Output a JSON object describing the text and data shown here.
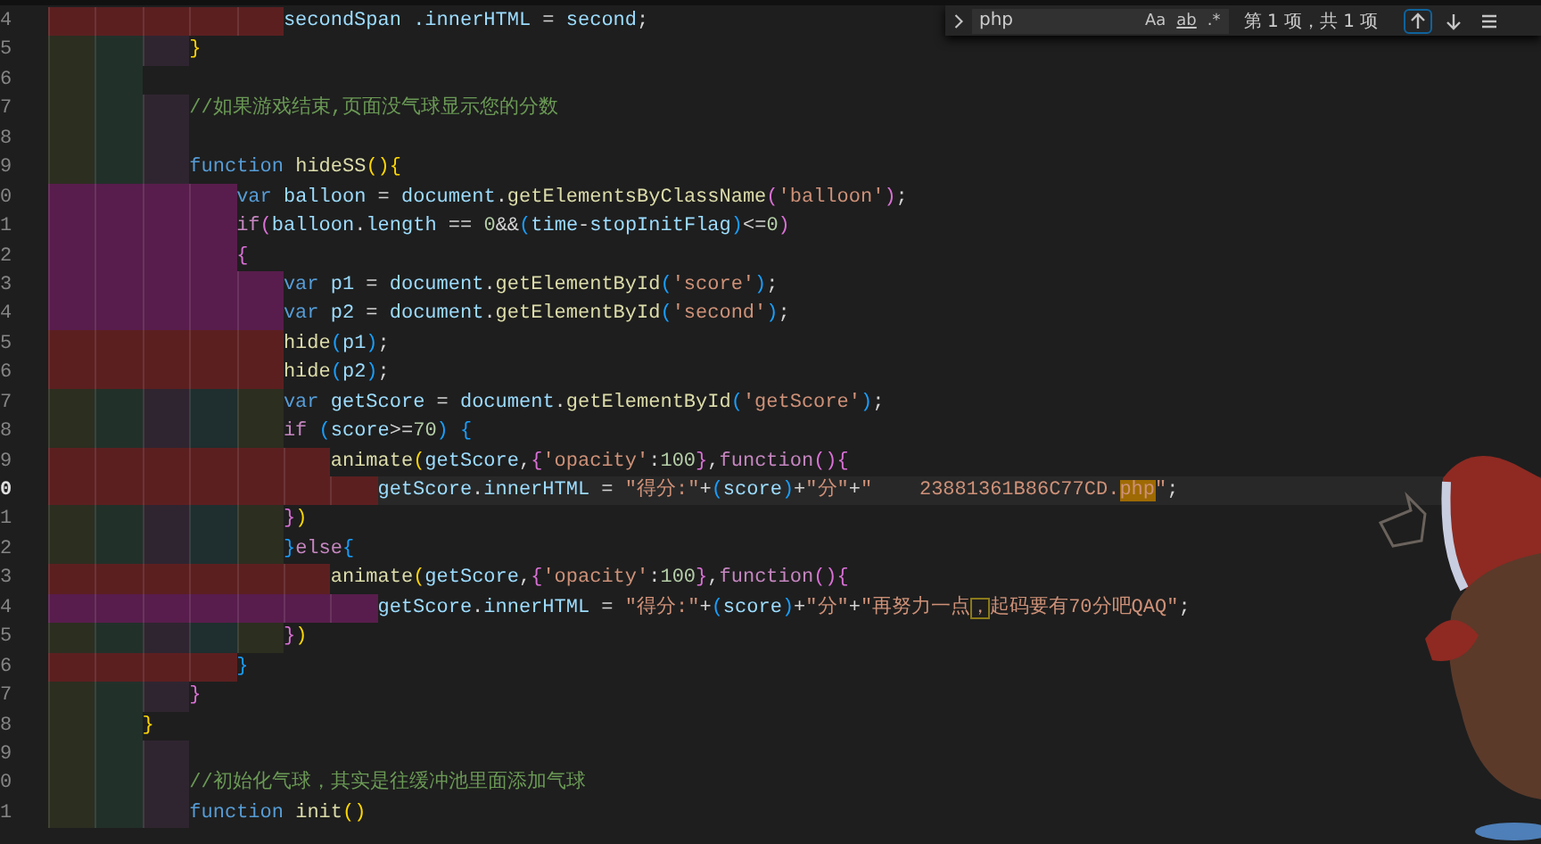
{
  "find": {
    "value": "php",
    "count": "第 1 项，共 1 项",
    "options": [
      {
        "kind": "case",
        "label": "Aa"
      },
      {
        "kind": "word",
        "label": "ab"
      },
      {
        "kind": "regex",
        "label": ".*"
      }
    ]
  },
  "lines": [
    {
      "number": "4",
      "current": false,
      "guides": [
        {
          "color": "#5c1f20"
        },
        {
          "color": "#5c1f20"
        },
        {
          "color": "#5c1f20"
        },
        {
          "color": "#5c1f20"
        },
        {
          "color": "#5c1f20"
        }
      ],
      "tokens": [
        {
          "text": "secondSpan .innerHTML",
          "kind": "id"
        },
        {
          "text": " = ",
          "kind": "op"
        },
        {
          "text": "second",
          "kind": "id"
        },
        {
          "text": ";",
          "kind": "op"
        }
      ]
    },
    {
      "number": "5",
      "current": false,
      "guides": [
        {
          "color": "#2c2e20"
        },
        {
          "color": "#22302a"
        },
        {
          "color": "#2f2530"
        }
      ],
      "tokens": [
        {
          "text": "}",
          "kind": "b1"
        }
      ]
    },
    {
      "number": "6",
      "current": false,
      "guides": [
        {
          "color": "#2c2e20"
        },
        {
          "color": "#22302a"
        }
      ]
    },
    {
      "number": "7",
      "current": false,
      "guides": [
        {
          "color": "#2c2e20"
        },
        {
          "color": "#22302a"
        },
        {
          "color": "#2f2530"
        }
      ],
      "tokens": [
        {
          "text": "//如果游戏结束,页面没气球显示您的分数",
          "kind": "cmt"
        }
      ]
    },
    {
      "number": "8",
      "current": false,
      "guides": [
        {
          "color": "#2c2e20"
        },
        {
          "color": "#22302a"
        },
        {
          "color": "#2f2530"
        }
      ]
    },
    {
      "number": "9",
      "current": false,
      "guides": [
        {
          "color": "#2c2e20"
        },
        {
          "color": "#22302a"
        },
        {
          "color": "#2f2530"
        }
      ],
      "tokens": [
        {
          "text": "function ",
          "kind": "kw"
        },
        {
          "text": "hideSS",
          "kind": "fn"
        },
        {
          "text": "(){",
          "kind": "b1"
        }
      ]
    },
    {
      "number": "0",
      "current": false,
      "guides": [
        {
          "color": "#581d4c"
        },
        {
          "color": "#581d4c"
        },
        {
          "color": "#581d4c"
        },
        {
          "color": "#581d4c"
        }
      ],
      "tokens": [
        {
          "text": "var ",
          "kind": "kw"
        },
        {
          "text": "balloon",
          "kind": "id"
        },
        {
          "text": " = ",
          "kind": "op"
        },
        {
          "text": "document",
          "kind": "id"
        },
        {
          "text": ".",
          "kind": "op"
        },
        {
          "text": "getElementsByClassName",
          "kind": "fn"
        },
        {
          "text": "(",
          "kind": "b2"
        },
        {
          "text": "'balloon'",
          "kind": "str"
        },
        {
          "text": ")",
          "kind": "b2"
        },
        {
          "text": ";",
          "kind": "op"
        }
      ]
    },
    {
      "number": "1",
      "current": false,
      "guides": [
        {
          "color": "#581d4c"
        },
        {
          "color": "#581d4c"
        },
        {
          "color": "#581d4c"
        },
        {
          "color": "#581d4c"
        }
      ],
      "tokens": [
        {
          "text": "if",
          "kind": "ctrl"
        },
        {
          "text": "(",
          "kind": "b2"
        },
        {
          "text": "balloon",
          "kind": "id"
        },
        {
          "text": ".",
          "kind": "op"
        },
        {
          "text": "length",
          "kind": "id"
        },
        {
          "text": " == ",
          "kind": "op"
        },
        {
          "text": "0",
          "kind": "num"
        },
        {
          "text": "&&",
          "kind": "op"
        },
        {
          "text": "(",
          "kind": "b3"
        },
        {
          "text": "time",
          "kind": "id"
        },
        {
          "text": "-",
          "kind": "op"
        },
        {
          "text": "stopInitFlag",
          "kind": "id"
        },
        {
          "text": ")",
          "kind": "b3"
        },
        {
          "text": "<=",
          "kind": "op"
        },
        {
          "text": "0",
          "kind": "num"
        },
        {
          "text": ")",
          "kind": "b2"
        }
      ]
    },
    {
      "number": "2",
      "current": false,
      "guides": [
        {
          "color": "#581d4c"
        },
        {
          "color": "#581d4c"
        },
        {
          "color": "#581d4c"
        },
        {
          "color": "#581d4c"
        }
      ],
      "tokens": [
        {
          "text": "{",
          "kind": "b2"
        }
      ]
    },
    {
      "number": "3",
      "current": false,
      "guides": [
        {
          "color": "#581d4c"
        },
        {
          "color": "#581d4c"
        },
        {
          "color": "#581d4c"
        },
        {
          "color": "#581d4c"
        },
        {
          "color": "#581d4c"
        }
      ],
      "tokens": [
        {
          "text": "var ",
          "kind": "kw"
        },
        {
          "text": "p1",
          "kind": "id"
        },
        {
          "text": " = ",
          "kind": "op"
        },
        {
          "text": "document",
          "kind": "id"
        },
        {
          "text": ".",
          "kind": "op"
        },
        {
          "text": "getElementById",
          "kind": "fn"
        },
        {
          "text": "(",
          "kind": "b3"
        },
        {
          "text": "'score'",
          "kind": "str"
        },
        {
          "text": ")",
          "kind": "b3"
        },
        {
          "text": ";",
          "kind": "op"
        }
      ]
    },
    {
      "number": "4",
      "current": false,
      "guides": [
        {
          "color": "#581d4c"
        },
        {
          "color": "#581d4c"
        },
        {
          "color": "#581d4c"
        },
        {
          "color": "#581d4c"
        },
        {
          "color": "#581d4c"
        }
      ],
      "tokens": [
        {
          "text": "var ",
          "kind": "kw"
        },
        {
          "text": "p2",
          "kind": "id"
        },
        {
          "text": " = ",
          "kind": "op"
        },
        {
          "text": "document",
          "kind": "id"
        },
        {
          "text": ".",
          "kind": "op"
        },
        {
          "text": "getElementById",
          "kind": "fn"
        },
        {
          "text": "(",
          "kind": "b3"
        },
        {
          "text": "'second'",
          "kind": "str"
        },
        {
          "text": ")",
          "kind": "b3"
        },
        {
          "text": ";",
          "kind": "op"
        }
      ]
    },
    {
      "number": "5",
      "current": false,
      "guides": [
        {
          "color": "#5c1f20"
        },
        {
          "color": "#5c1f20"
        },
        {
          "color": "#5c1f20"
        },
        {
          "color": "#5c1f20"
        },
        {
          "color": "#5c1f20"
        }
      ],
      "tokens": [
        {
          "text": "hide",
          "kind": "fn"
        },
        {
          "text": "(",
          "kind": "b3"
        },
        {
          "text": "p1",
          "kind": "id"
        },
        {
          "text": ")",
          "kind": "b3"
        },
        {
          "text": ";",
          "kind": "op"
        }
      ]
    },
    {
      "number": "6",
      "current": false,
      "guides": [
        {
          "color": "#5c1f20"
        },
        {
          "color": "#5c1f20"
        },
        {
          "color": "#5c1f20"
        },
        {
          "color": "#5c1f20"
        },
        {
          "color": "#5c1f20"
        }
      ],
      "tokens": [
        {
          "text": "hide",
          "kind": "fn"
        },
        {
          "text": "(",
          "kind": "b3"
        },
        {
          "text": "p2",
          "kind": "id"
        },
        {
          "text": ")",
          "kind": "b3"
        },
        {
          "text": ";",
          "kind": "op"
        }
      ]
    },
    {
      "number": "7",
      "current": false,
      "guides": [
        {
          "color": "#2c2e20"
        },
        {
          "color": "#22302a"
        },
        {
          "color": "#2f2530"
        },
        {
          "color": "#1f2e2e"
        },
        {
          "color": "#2c2e20"
        }
      ],
      "tokens": [
        {
          "text": "var ",
          "kind": "kw"
        },
        {
          "text": "getScore",
          "kind": "id"
        },
        {
          "text": " = ",
          "kind": "op"
        },
        {
          "text": "document",
          "kind": "id"
        },
        {
          "text": ".",
          "kind": "op"
        },
        {
          "text": "getElementById",
          "kind": "fn"
        },
        {
          "text": "(",
          "kind": "b3"
        },
        {
          "text": "'getScore'",
          "kind": "str"
        },
        {
          "text": ")",
          "kind": "b3"
        },
        {
          "text": ";",
          "kind": "op"
        }
      ]
    },
    {
      "number": "8",
      "current": false,
      "guides": [
        {
          "color": "#2c2e20"
        },
        {
          "color": "#22302a"
        },
        {
          "color": "#2f2530"
        },
        {
          "color": "#1f2e2e"
        },
        {
          "color": "#2c2e20"
        }
      ],
      "tokens": [
        {
          "text": "if ",
          "kind": "ctrl"
        },
        {
          "text": "(",
          "kind": "b3"
        },
        {
          "text": "score",
          "kind": "id"
        },
        {
          "text": ">=",
          "kind": "op"
        },
        {
          "text": "70",
          "kind": "num"
        },
        {
          "text": ")",
          "kind": "b3"
        },
        {
          "text": " {",
          "kind": "b3"
        }
      ]
    },
    {
      "number": "9",
      "current": false,
      "guides": [
        {
          "color": "#5c1f20"
        },
        {
          "color": "#5c1f20"
        },
        {
          "color": "#5c1f20"
        },
        {
          "color": "#5c1f20"
        },
        {
          "color": "#5c1f20"
        },
        {
          "color": "#5c1f20"
        }
      ],
      "tokens": [
        {
          "text": "animate",
          "kind": "fn"
        },
        {
          "text": "(",
          "kind": "b1"
        },
        {
          "text": "getScore",
          "kind": "id"
        },
        {
          "text": ",",
          "kind": "op"
        },
        {
          "text": "{",
          "kind": "b2"
        },
        {
          "text": "'opacity'",
          "kind": "str"
        },
        {
          "text": ":",
          "kind": "op"
        },
        {
          "text": "100",
          "kind": "num"
        },
        {
          "text": "}",
          "kind": "b2"
        },
        {
          "text": ",",
          "kind": "op"
        },
        {
          "text": "function",
          "kind": "ctrl"
        },
        {
          "text": "(){",
          "kind": "b2"
        }
      ]
    },
    {
      "number": "0",
      "current": true,
      "guides": [
        {
          "color": "#5c1f20"
        },
        {
          "color": "#5c1f20"
        },
        {
          "color": "#5c1f20"
        },
        {
          "color": "#5c1f20"
        },
        {
          "color": "#5c1f20"
        },
        {
          "color": "#5c1f20"
        },
        {
          "color": "#5c1f20"
        }
      ],
      "tokens": [
        {
          "text": "getScore",
          "kind": "id"
        },
        {
          "text": ".",
          "kind": "op"
        },
        {
          "text": "innerHTML",
          "kind": "id"
        },
        {
          "text": " = ",
          "kind": "op"
        },
        {
          "text": "\"得分:\"",
          "kind": "str"
        },
        {
          "text": "+",
          "kind": "op"
        },
        {
          "text": "(",
          "kind": "b3"
        },
        {
          "text": "score",
          "kind": "id"
        },
        {
          "text": ")",
          "kind": "b3"
        },
        {
          "text": "+",
          "kind": "op"
        },
        {
          "text": "\"分\"",
          "kind": "str"
        },
        {
          "text": "+",
          "kind": "op"
        },
        {
          "text": "\"    23881361B86C77CD.",
          "kind": "str"
        },
        {
          "text": "php",
          "kind": "match"
        },
        {
          "text": "\"",
          "kind": "str"
        },
        {
          "text": ";",
          "kind": "op"
        }
      ]
    },
    {
      "number": "1",
      "current": false,
      "guides": [
        {
          "color": "#2c2e20"
        },
        {
          "color": "#22302a"
        },
        {
          "color": "#2f2530"
        },
        {
          "color": "#1f2e2e"
        },
        {
          "color": "#2c2e20"
        }
      ],
      "tokens": [
        {
          "text": "}",
          "kind": "b2"
        },
        {
          "text": ")",
          "kind": "b1"
        }
      ]
    },
    {
      "number": "2",
      "current": false,
      "guides": [
        {
          "color": "#2c2e20"
        },
        {
          "color": "#22302a"
        },
        {
          "color": "#2f2530"
        },
        {
          "color": "#1f2e2e"
        },
        {
          "color": "#2c2e20"
        }
      ],
      "tokens": [
        {
          "text": "}",
          "kind": "b3"
        },
        {
          "text": "else",
          "kind": "ctrl"
        },
        {
          "text": "{",
          "kind": "b3"
        }
      ]
    },
    {
      "number": "3",
      "current": false,
      "guides": [
        {
          "color": "#5c1f20"
        },
        {
          "color": "#5c1f20"
        },
        {
          "color": "#5c1f20"
        },
        {
          "color": "#5c1f20"
        },
        {
          "color": "#5c1f20"
        },
        {
          "color": "#5c1f20"
        }
      ],
      "tokens": [
        {
          "text": "animate",
          "kind": "fn"
        },
        {
          "text": "(",
          "kind": "b1"
        },
        {
          "text": "getScore",
          "kind": "id"
        },
        {
          "text": ",",
          "kind": "op"
        },
        {
          "text": "{",
          "kind": "b2"
        },
        {
          "text": "'opacity'",
          "kind": "str"
        },
        {
          "text": ":",
          "kind": "op"
        },
        {
          "text": "100",
          "kind": "num"
        },
        {
          "text": "}",
          "kind": "b2"
        },
        {
          "text": ",",
          "kind": "op"
        },
        {
          "text": "function",
          "kind": "ctrl"
        },
        {
          "text": "(){",
          "kind": "b2"
        }
      ]
    },
    {
      "number": "4",
      "current": false,
      "guides": [
        {
          "color": "#581d4c"
        },
        {
          "color": "#581d4c"
        },
        {
          "color": "#581d4c"
        },
        {
          "color": "#581d4c"
        },
        {
          "color": "#581d4c"
        },
        {
          "color": "#581d4c"
        },
        {
          "color": "#581d4c"
        }
      ],
      "tokens": [
        {
          "text": "getScore",
          "kind": "id"
        },
        {
          "text": ".",
          "kind": "op"
        },
        {
          "text": "innerHTML",
          "kind": "id"
        },
        {
          "text": " = ",
          "kind": "op"
        },
        {
          "text": "\"得分:\"",
          "kind": "str"
        },
        {
          "text": "+",
          "kind": "op"
        },
        {
          "text": "(",
          "kind": "b3"
        },
        {
          "text": "score",
          "kind": "id"
        },
        {
          "text": ")",
          "kind": "b3"
        },
        {
          "text": "+",
          "kind": "op"
        },
        {
          "text": "\"分\"",
          "kind": "str"
        },
        {
          "text": "+",
          "kind": "op"
        },
        {
          "text": "\"再努力一点",
          "kind": "str"
        },
        {
          "text": "，",
          "kind": "flag"
        },
        {
          "text": "起码要有70分吧QAQ\"",
          "kind": "str"
        },
        {
          "text": ";",
          "kind": "op"
        }
      ]
    },
    {
      "number": "5",
      "current": false,
      "guides": [
        {
          "color": "#2c2e20"
        },
        {
          "color": "#22302a"
        },
        {
          "color": "#2f2530"
        },
        {
          "color": "#1f2e2e"
        },
        {
          "color": "#2c2e20"
        }
      ],
      "tokens": [
        {
          "text": "}",
          "kind": "b2"
        },
        {
          "text": ")",
          "kind": "b1"
        }
      ]
    },
    {
      "number": "6",
      "current": false,
      "guides": [
        {
          "color": "#5c1f20"
        },
        {
          "color": "#5c1f20"
        },
        {
          "color": "#5c1f20"
        },
        {
          "color": "#5c1f20"
        }
      ],
      "tokens": [
        {
          "text": "}",
          "kind": "b3"
        }
      ]
    },
    {
      "number": "7",
      "current": false,
      "guides": [
        {
          "color": "#2c2e20"
        },
        {
          "color": "#22302a"
        },
        {
          "color": "#2f2530"
        }
      ],
      "tokens": [
        {
          "text": "}",
          "kind": "b2"
        }
      ]
    },
    {
      "number": "8",
      "current": false,
      "guides": [
        {
          "color": "#2c2e20"
        },
        {
          "color": "#22302a"
        }
      ],
      "tokens": [
        {
          "text": "}",
          "kind": "b1"
        }
      ]
    },
    {
      "number": "9",
      "current": false,
      "guides": [
        {
          "color": "#2c2e20"
        },
        {
          "color": "#22302a"
        },
        {
          "color": "#2f2530"
        }
      ]
    },
    {
      "number": "0",
      "current": false,
      "guides": [
        {
          "color": "#2c2e20"
        },
        {
          "color": "#22302a"
        },
        {
          "color": "#2f2530"
        }
      ],
      "tokens": [
        {
          "text": "//初始化气球，其实是往缓冲池里面添加气球",
          "kind": "cmt"
        }
      ]
    },
    {
      "number": "1",
      "current": false,
      "guides": [
        {
          "color": "#2c2e20"
        },
        {
          "color": "#22302a"
        },
        {
          "color": "#2f2530"
        }
      ],
      "tokens": [
        {
          "text": "function ",
          "kind": "kw"
        },
        {
          "text": "init",
          "kind": "fn"
        },
        {
          "text": "()",
          "kind": "b1"
        }
      ]
    }
  ]
}
